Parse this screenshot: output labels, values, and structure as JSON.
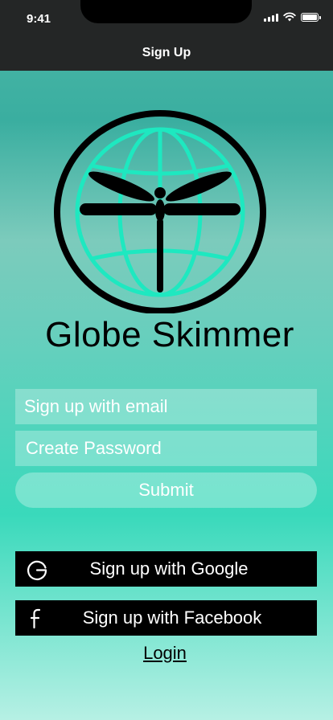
{
  "status_bar": {
    "time": "9:41"
  },
  "header": {
    "title": "Sign Up"
  },
  "brand": {
    "name": "Globe Skimmer",
    "accent": "#1ee8c0"
  },
  "form": {
    "email_placeholder": "Sign up with email",
    "password_placeholder": "Create Password",
    "submit_label": "Submit"
  },
  "social": {
    "google_label": "Sign up with Google",
    "google_icon": "google-g-icon",
    "facebook_label": "Sign up with Facebook",
    "facebook_icon": "facebook-f-icon"
  },
  "login_label": "Login"
}
